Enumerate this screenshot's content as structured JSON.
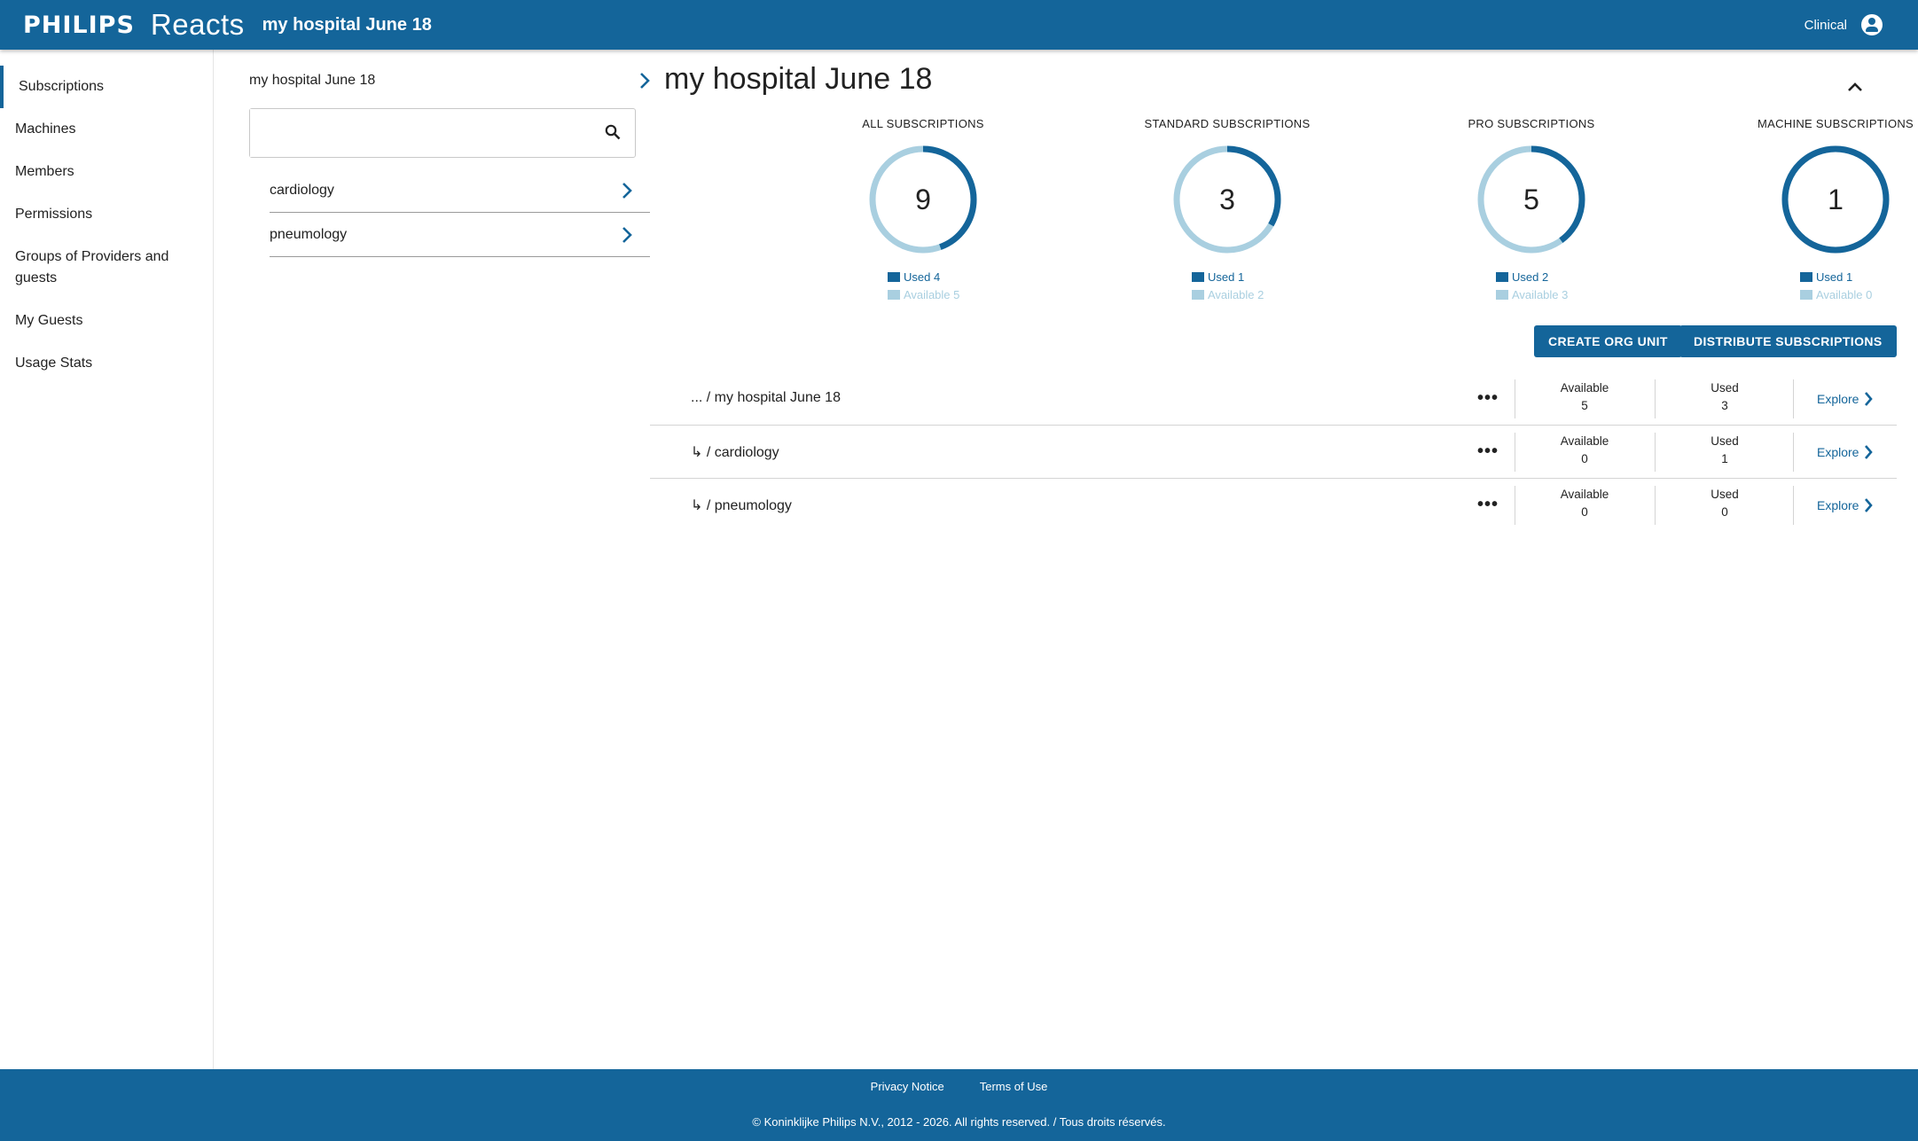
{
  "header": {
    "brand": "PHILIPS",
    "product": "Reacts",
    "title": "my hospital June 18",
    "role": "Clinical",
    "icons": {
      "user": "account-circle-icon"
    }
  },
  "sidebar": {
    "items": [
      {
        "label": "Subscriptions",
        "active": true
      },
      {
        "label": "Machines"
      },
      {
        "label": "Members"
      },
      {
        "label": "Permissions"
      },
      {
        "label": "Groups of Providers and guests"
      },
      {
        "label": "My Guests"
      },
      {
        "label": "Usage Stats"
      }
    ]
  },
  "tree": {
    "root": "my hospital June 18",
    "search": {
      "value": "",
      "placeholder": ""
    },
    "children": [
      "cardiology",
      "pneumology"
    ]
  },
  "main": {
    "title": "my hospital June 18",
    "cards": [
      {
        "title": "ALL SUBSCRIPTIONS",
        "total": "9",
        "used": 4,
        "available": 5,
        "used_label": "Used 4",
        "available_label": "Available 5"
      },
      {
        "title": "STANDARD SUBSCRIPTIONS",
        "total": "3",
        "used": 1,
        "available": 2,
        "used_label": "Used 1",
        "available_label": "Available 2"
      },
      {
        "title": "PRO SUBSCRIPTIONS",
        "total": "5",
        "used": 2,
        "available": 3,
        "used_label": "Used 2",
        "available_label": "Available 3"
      },
      {
        "title": "MACHINE SUBSCRIPTIONS",
        "total": "1",
        "used": 1,
        "available": 0,
        "used_label": "Used 1",
        "available_label": "Available 0"
      }
    ],
    "buttons": {
      "create": "CREATE ORG UNIT",
      "distribute": "DISTRIBUTE SUBSCRIPTIONS"
    },
    "table": {
      "available_header": "Available",
      "used_header": "Used",
      "explore_label": "Explore",
      "rows": [
        {
          "prefix": "... / ",
          "name": "my hospital June 18",
          "available": "5",
          "used": "3"
        },
        {
          "prefix": "↳ / ",
          "name": "cardiology",
          "available": "0",
          "used": "1"
        },
        {
          "prefix": "↳ / ",
          "name": "pneumology",
          "available": "0",
          "used": "0"
        }
      ]
    }
  },
  "footer": {
    "privacy": "Privacy Notice",
    "terms": "Terms of Use",
    "copyright": "© Koninklijke Philips N.V., 2012 - 2026. All rights reserved. / Tous droits réservés."
  },
  "colors": {
    "primary": "#14659a",
    "available": "#a9cfe0"
  }
}
